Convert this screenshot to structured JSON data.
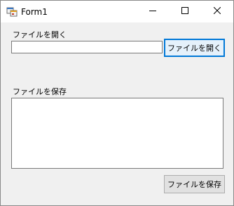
{
  "window": {
    "title": "Form1",
    "icon": "winforms-app-icon",
    "controls": {
      "minimize_icon": "minimize-icon",
      "maximize_icon": "maximize-icon",
      "close_icon": "close-icon"
    }
  },
  "open_section": {
    "label": "ファイルを開く",
    "path_value": "",
    "button_label": "ファイルを開く"
  },
  "save_section": {
    "label": "ファイルを保存",
    "content_value": "",
    "button_label": "ファイルを保存"
  },
  "colors": {
    "form_background": "#f0f0f0",
    "titlebar_background": "#ffffff",
    "focus_accent": "#0078d7",
    "button_face": "#e1e1e1"
  }
}
